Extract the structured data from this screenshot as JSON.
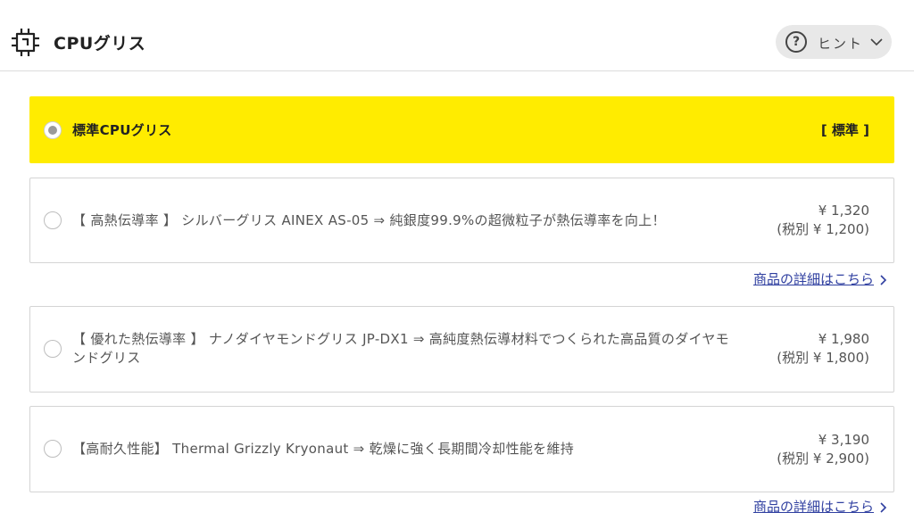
{
  "header": {
    "title": "CPUグリス",
    "hint_label": "ヒント"
  },
  "options": [
    {
      "label": "標準CPUグリス",
      "tag": "[ 標準 ]",
      "selected": true
    },
    {
      "label": "【 高熱伝導率 】 シルバーグリス AINEX AS-05 ⇒ 純銀度99.9%の超微粒子が熱伝導率を向上！",
      "price": "¥ 1,320",
      "price_ex_tax": "(税別 ¥ 1,200)",
      "selected": false
    },
    {
      "label": "【 優れた熱伝導率 】 ナノダイヤモンドグリス JP-DX1 ⇒ 高純度熱伝導材料でつくられた高品質のダイヤモンドグリス",
      "price": "¥ 1,980",
      "price_ex_tax": "(税別 ¥ 1,800)",
      "selected": false
    },
    {
      "label": "【高耐久性能】 Thermal Grizzly Kryonaut ⇒ 乾燥に強く長期間冷却性能を維持",
      "price": "¥ 3,190",
      "price_ex_tax": "(税別 ¥ 2,900)",
      "selected": false
    }
  ],
  "links": {
    "detail_1": "商品の詳細はこちら",
    "detail_2": "商品の詳細はこちら"
  },
  "colors": {
    "selected_bg": "#ffec00",
    "link": "#2f3fa0"
  },
  "icons": {
    "header": "cpu-chip-icon",
    "hint": "question-circle-icon",
    "hint_toggle": "chevron-down-icon",
    "link_arrow": "chevron-right-icon"
  }
}
